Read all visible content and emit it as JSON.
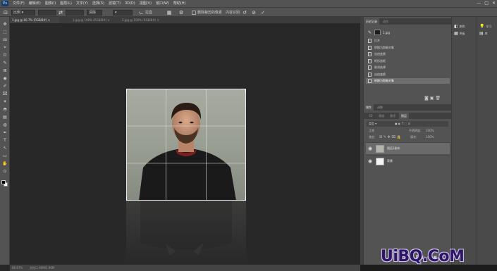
{
  "app": {
    "logo": "Ps",
    "menu": [
      "文件(F)",
      "编辑(E)",
      "图像(I)",
      "图层(L)",
      "文字(Y)",
      "选择(S)",
      "滤镜(T)",
      "3D(D)",
      "视图(V)",
      "窗口(W)",
      "帮助(H)"
    ],
    "window_controls": [
      "—",
      "□",
      "✕"
    ]
  },
  "options": {
    "ratio_select": "比例",
    "width_value": "",
    "height_value": "",
    "clear_label": "清除",
    "straighten_label": "拉直",
    "overlay_icon": "grid-icon",
    "delete_pixels_label": "删除裁剪的像素",
    "content_aware_label": "内容识别",
    "reset_symbol": "↺",
    "cancel_symbol": "⊘",
    "commit_symbol": "✓"
  },
  "tabs": [
    {
      "label": "1.jpg @ 66.7% (RGB/8#) ×",
      "active": true
    },
    {
      "label": "1.jpg @ 100% (RGB/8#) ×",
      "active": false
    },
    {
      "label": "2.jpg @ 100% (RGB/8#) ×",
      "active": false
    }
  ],
  "tools": [
    "✥",
    "⬚",
    "ꝏ",
    "⌖",
    "⊡",
    "✎",
    "⊞",
    "◉",
    "✐",
    "⌧",
    "✦",
    "◓",
    "▤",
    "◍",
    "✒",
    "T",
    "↖",
    "▭",
    "✋",
    "⊙"
  ],
  "status": {
    "zoom": "66.67%",
    "doc": "文档:1.90M/1.90M"
  },
  "history": {
    "tabs": [
      "历史记录",
      "动作"
    ],
    "snapshot_label": "1.jpg",
    "items": [
      "打开",
      "转换为智能对象",
      "自由变换",
      "矩形选框",
      "取消选择",
      "自由变换",
      "转换为智能对象"
    ],
    "selected_index": 6
  },
  "layers_panel": {
    "tabs_top": [
      "属性",
      "调整"
    ],
    "tabs": [
      "3D",
      "通道",
      "路径",
      "图层"
    ],
    "kind_filter": "类型",
    "blend_mode": "正常",
    "opacity_label": "不透明度:",
    "opacity_value": "100%",
    "lock_label": "锁定:",
    "fill_label": "填充:",
    "fill_value": "100%",
    "layers": [
      {
        "name": "图层1副本",
        "selected": true
      },
      {
        "name": "背景",
        "selected": false
      }
    ]
  },
  "side_panel": {
    "items": [
      {
        "icon": "color-icon",
        "label": "颜色"
      },
      {
        "icon": "swatches-icon",
        "label": "色板"
      }
    ],
    "right_items": [
      {
        "icon": "learn-icon",
        "label": "学习"
      },
      {
        "icon": "libraries-icon",
        "label": "库"
      }
    ]
  },
  "watermark": "UiBQ.CoM"
}
